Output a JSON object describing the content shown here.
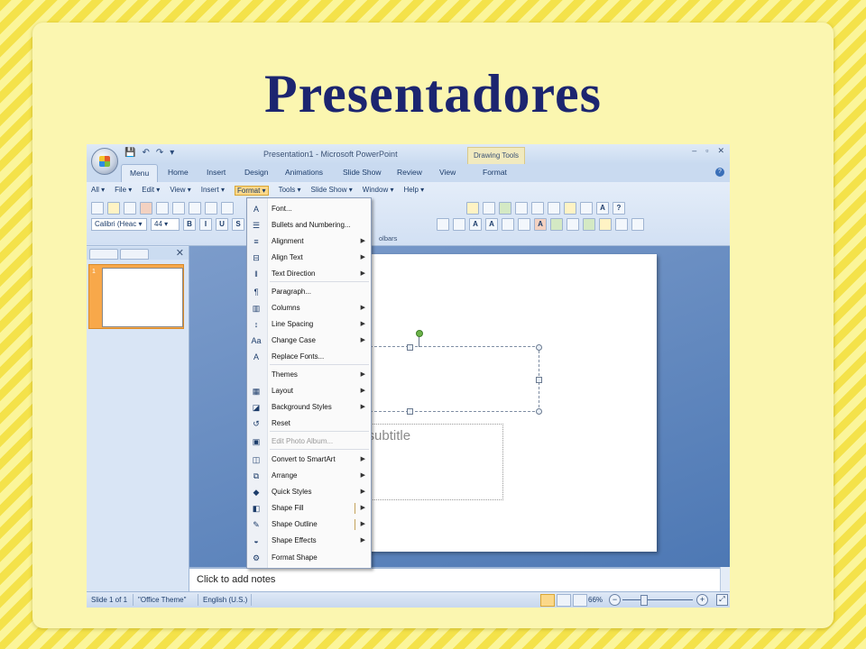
{
  "slide_title": "Presentadores",
  "window": {
    "title": "Presentation1 - Microsoft PowerPoint",
    "context_tab_group": "Drawing Tools",
    "controls": [
      "–",
      "▫",
      "✕"
    ]
  },
  "qat": {
    "save": "💾",
    "undo": "↶",
    "redo": "↷",
    "customize": "▾"
  },
  "tabs": [
    "Menu",
    "Home",
    "Insert",
    "Design",
    "Animations",
    "Slide Show",
    "Review",
    "View",
    "Format"
  ],
  "menu_bar": [
    "All ▾",
    "File ▾",
    "Edit ▾",
    "View ▾",
    "Insert ▾",
    "Format ▾",
    "Tools ▾",
    "Slide Show ▾",
    "Window ▾",
    "Help ▾"
  ],
  "font_toolbar": {
    "font": "Calibri (Heac ▾",
    "size": "44 ▾",
    "bold": "B",
    "italic": "I",
    "underline": "U",
    "shadow": "S"
  },
  "toolbars_label": "olbars",
  "left_pane": {
    "close": "✕",
    "slide_number": "1"
  },
  "slide": {
    "subtitle_placeholder": "Click to add subtitle"
  },
  "notes_placeholder": "Click to add notes",
  "status": {
    "slide": "Slide 1 of 1",
    "theme": "\"Office Theme\"",
    "language": "English (U.S.)",
    "zoom": "66%",
    "zoom_minus": "−",
    "zoom_plus": "+"
  },
  "format_menu": [
    {
      "label": "Font...",
      "icon": "A",
      "arrow": ""
    },
    {
      "label": "Bullets and Numbering...",
      "icon": "☰",
      "arrow": ""
    },
    {
      "label": "Alignment",
      "icon": "≡",
      "arrow": "▶"
    },
    {
      "label": "Align Text",
      "icon": "⊟",
      "arrow": "▶"
    },
    {
      "label": "Text Direction",
      "icon": "‖",
      "arrow": "▶"
    },
    {
      "label": "Paragraph...",
      "icon": "¶",
      "arrow": ""
    },
    {
      "label": "Columns",
      "icon": "▥",
      "arrow": "▶"
    },
    {
      "label": "Line Spacing",
      "icon": "↕",
      "arrow": "▶"
    },
    {
      "label": "Change Case",
      "icon": "Aa",
      "arrow": "▶"
    },
    {
      "label": "Replace Fonts...",
      "icon": "A",
      "arrow": ""
    },
    {
      "label": "Themes",
      "icon": "",
      "arrow": "▶"
    },
    {
      "label": "Layout",
      "icon": "▦",
      "arrow": "▶"
    },
    {
      "label": "Background Styles",
      "icon": "◪",
      "arrow": "▶"
    },
    {
      "label": "Reset",
      "icon": "↺",
      "arrow": ""
    },
    {
      "label": "Edit Photo Album...",
      "icon": "▣",
      "arrow": ""
    },
    {
      "label": "Convert to SmartArt",
      "icon": "◫",
      "arrow": "▶"
    },
    {
      "label": "Arrange",
      "icon": "⧉",
      "arrow": "▶"
    },
    {
      "label": "Quick Styles",
      "icon": "◆",
      "arrow": "▶"
    },
    {
      "label": "Shape Fill",
      "icon": "◧",
      "arrow": "▶"
    },
    {
      "label": "Shape Outline",
      "icon": "✎",
      "arrow": "▶"
    },
    {
      "label": "Shape Effects",
      "icon": "◒",
      "arrow": "▶"
    },
    {
      "label": "Format Shape",
      "icon": "⚙",
      "arrow": ""
    }
  ]
}
